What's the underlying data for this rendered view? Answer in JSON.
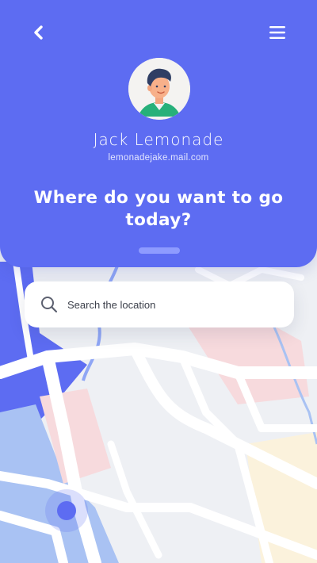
{
  "colors": {
    "primary": "#5d6cf2",
    "map_background": "#eef0f4",
    "road": "#ffffff",
    "river": "#8fa6f5",
    "water": "#a9c2f3",
    "zone_pink": "#f7dadd",
    "zone_yellow": "#fbf2dc"
  },
  "header": {
    "back_icon": "chevron-left-icon",
    "menu_icon": "hamburger-menu-icon"
  },
  "profile": {
    "name": "Jack Lemonade",
    "email": "lemonadejake.mail.com",
    "avatar_icon": "user-avatar"
  },
  "prompt": "Where do you want to go today?",
  "search": {
    "placeholder": "Search the location",
    "value": "",
    "icon": "search-icon"
  },
  "map": {
    "marker_icon": "current-location-icon"
  }
}
